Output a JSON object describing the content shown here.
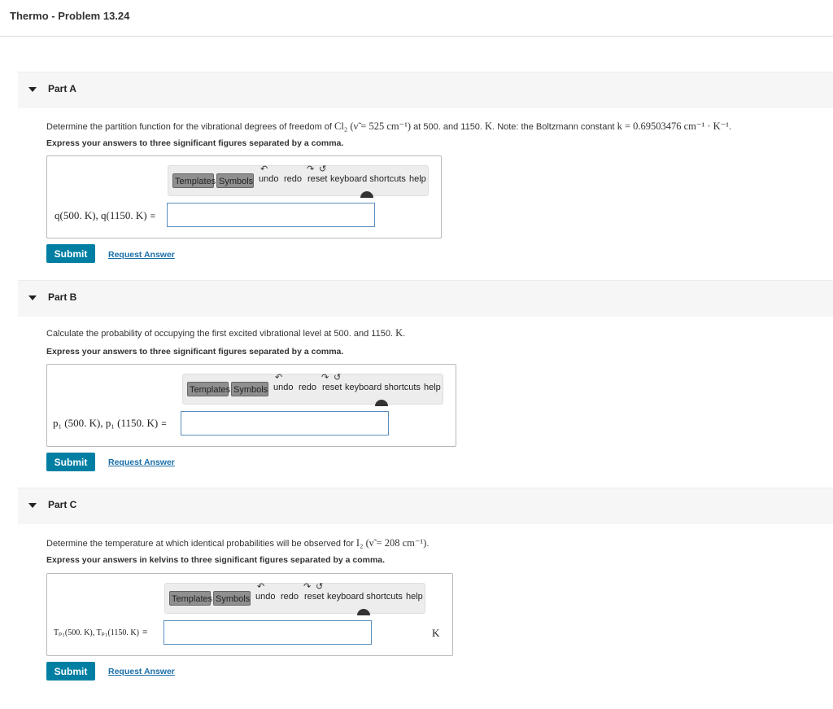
{
  "header": {
    "title": "Thermo - Problem 13.24"
  },
  "toolbar": {
    "templates": "Templates",
    "symbols": "Symbols",
    "undo": "undo",
    "redo": "redo",
    "reset": "reset",
    "keyboard": "keyboard shortcuts",
    "help": "help"
  },
  "parts": [
    {
      "label": "Part A",
      "question": {
        "p1": "Determine the partition function for the vibrational degrees of freedom of ",
        "m1": "Cl₂",
        "m2": " (ν̃ = 525 cm⁻¹)",
        "p2": " at 500. and 1150. ",
        "m3": "K",
        "p3": ". Note: the Boltzmann constant ",
        "m4": "k = 0.69503476 cm⁻¹ · K⁻¹",
        "p4": "."
      },
      "instruction": "Express your answers to three significant figures separated by a comma.",
      "expression": "q(500. K), q(1150. K)",
      "equals": "=",
      "input_value": "",
      "unit": "",
      "submit": "Submit",
      "request": "Request Answer"
    },
    {
      "label": "Part B",
      "question": {
        "p1": "Calculate the probability of occupying the first excited vibrational level at 500. and 1150. ",
        "m1": "K",
        "p2": "."
      },
      "instruction": "Express your answers to three significant figures separated by a comma.",
      "expression": "p₁ (500. K), p₁ (1150. K)",
      "equals": "=",
      "input_value": "",
      "unit": "",
      "submit": "Submit",
      "request": "Request Answer"
    },
    {
      "label": "Part C",
      "question": {
        "p1": "Determine the temperature at which identical probabilities will be observed for ",
        "m1": "I₂",
        "m2": " (ν̃ = 208 cm⁻¹)",
        "p2": "."
      },
      "instruction": "Express your answers in kelvins to three significant figures separated by a comma.",
      "expression": "Tₚ₁(500. K), Tₚ₁(1150. K)",
      "equals": "=",
      "input_value": "",
      "unit": "K",
      "submit": "Submit",
      "request": "Request Answer"
    }
  ]
}
